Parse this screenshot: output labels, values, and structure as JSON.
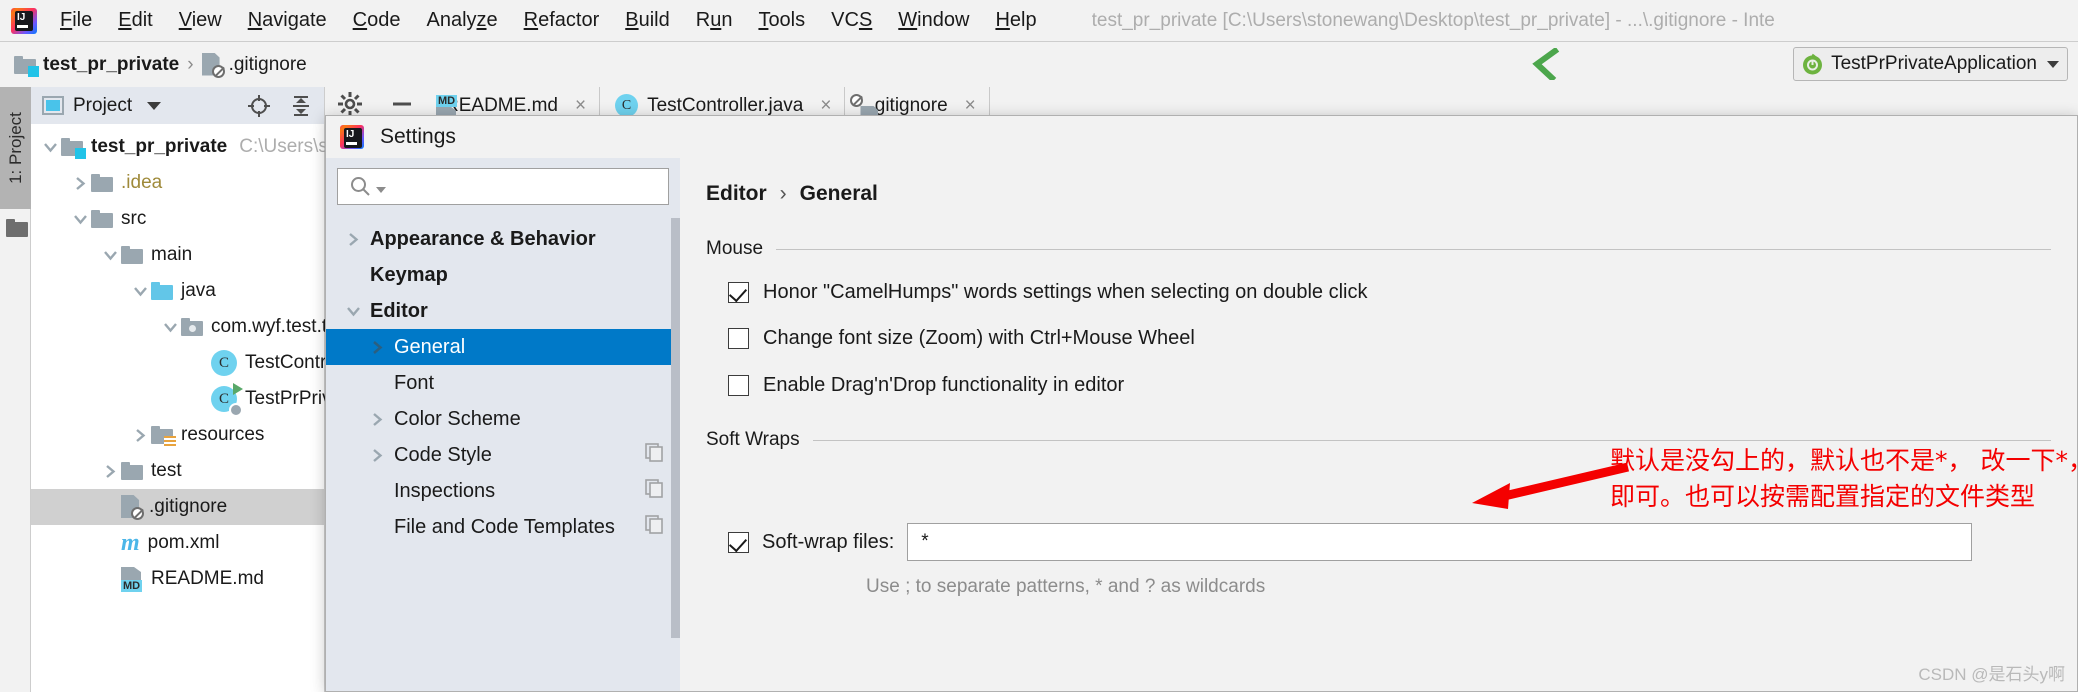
{
  "window": {
    "title": "test_pr_private [C:\\Users\\stonewang\\Desktop\\test_pr_private] - ...\\.gitignore - Inte",
    "logo_text": "IJ"
  },
  "menu": [
    {
      "label": "File",
      "mnemonic": "F"
    },
    {
      "label": "Edit",
      "mnemonic": "E"
    },
    {
      "label": "View",
      "mnemonic": "V"
    },
    {
      "label": "Navigate",
      "mnemonic": "N"
    },
    {
      "label": "Code",
      "mnemonic": "C"
    },
    {
      "label": "Analyze",
      "mnemonic": "z"
    },
    {
      "label": "Refactor",
      "mnemonic": "R"
    },
    {
      "label": "Build",
      "mnemonic": "B"
    },
    {
      "label": "Run",
      "mnemonic": "u"
    },
    {
      "label": "Tools",
      "mnemonic": "T"
    },
    {
      "label": "VCS",
      "mnemonic": "S"
    },
    {
      "label": "Window",
      "mnemonic": "W"
    },
    {
      "label": "Help",
      "mnemonic": "H"
    }
  ],
  "navbar": {
    "crumb_project": "test_pr_private",
    "crumb_file": ".gitignore",
    "separator": "›",
    "run_config": "TestPrPrivateApplication"
  },
  "tool_stripe": {
    "project_tab": "1: Project"
  },
  "project_panel": {
    "header_title": "Project",
    "tree": [
      {
        "label": "test_pr_private",
        "path": "C:\\Users\\sto",
        "depth": 0,
        "icon": "folder-module",
        "twisty": "down",
        "bold": true,
        "selected": false
      },
      {
        "label": ".idea",
        "path": "",
        "depth": 1,
        "icon": "folder",
        "twisty": "right",
        "bold": false,
        "selected": false
      },
      {
        "label": "src",
        "path": "",
        "depth": 1,
        "icon": "folder",
        "twisty": "down",
        "bold": false,
        "selected": false
      },
      {
        "label": "main",
        "path": "",
        "depth": 2,
        "icon": "folder",
        "twisty": "down",
        "bold": false,
        "selected": false
      },
      {
        "label": "java",
        "path": "",
        "depth": 3,
        "icon": "folder-source",
        "twisty": "down",
        "bold": false,
        "selected": false
      },
      {
        "label": "com.wyf.test.t",
        "path": "",
        "depth": 4,
        "icon": "folder-package",
        "twisty": "down",
        "bold": false,
        "selected": false
      },
      {
        "label": "TestContr",
        "path": "",
        "depth": 5,
        "icon": "java-class",
        "twisty": "none",
        "bold": false,
        "selected": false
      },
      {
        "label": "TestPrPriv",
        "path": "",
        "depth": 5,
        "icon": "java-class-runnable",
        "twisty": "none",
        "bold": false,
        "selected": false
      },
      {
        "label": "resources",
        "path": "",
        "depth": 3,
        "icon": "folder-resources",
        "twisty": "right",
        "bold": false,
        "selected": false
      },
      {
        "label": "test",
        "path": "",
        "depth": 2,
        "icon": "folder",
        "twisty": "right",
        "bold": false,
        "selected": false
      },
      {
        "label": ".gitignore",
        "path": "",
        "depth": 2,
        "icon": "gitignore-file",
        "twisty": "none",
        "bold": false,
        "selected": true
      },
      {
        "label": "pom.xml",
        "path": "",
        "depth": 2,
        "icon": "maven-file",
        "twisty": "none",
        "bold": false,
        "selected": false
      },
      {
        "label": "README.md",
        "path": "",
        "depth": 2,
        "icon": "markdown-file",
        "twisty": "none",
        "bold": false,
        "selected": false
      }
    ]
  },
  "editor_tabs": [
    {
      "label": "README.md",
      "icon": "markdown-file",
      "close": "×",
      "active": false
    },
    {
      "label": "TestController.java",
      "icon": "java-class",
      "close": "×",
      "active": false
    },
    {
      "label": ".gitignore",
      "icon": "gitignore-file",
      "close": "×",
      "active": true
    }
  ],
  "settings_dialog": {
    "title": "Settings",
    "search_placeholder": "",
    "search_value": "",
    "tree": [
      {
        "label": "Appearance & Behavior",
        "twisty": "right",
        "bold": true,
        "indent": 0,
        "selected": false,
        "copy_icon": false
      },
      {
        "label": "Keymap",
        "twisty": "none",
        "bold": true,
        "indent": 0,
        "selected": false,
        "copy_icon": false
      },
      {
        "label": "Editor",
        "twisty": "down",
        "bold": true,
        "indent": 0,
        "selected": false,
        "copy_icon": false
      },
      {
        "label": "General",
        "twisty": "right",
        "bold": false,
        "indent": 1,
        "selected": true,
        "copy_icon": false
      },
      {
        "label": "Font",
        "twisty": "none",
        "bold": false,
        "indent": 1,
        "selected": false,
        "copy_icon": false
      },
      {
        "label": "Color Scheme",
        "twisty": "right",
        "bold": false,
        "indent": 1,
        "selected": false,
        "copy_icon": false
      },
      {
        "label": "Code Style",
        "twisty": "right",
        "bold": false,
        "indent": 1,
        "selected": false,
        "copy_icon": true
      },
      {
        "label": "Inspections",
        "twisty": "none",
        "bold": false,
        "indent": 1,
        "selected": false,
        "copy_icon": true
      },
      {
        "label": "File and Code Templates",
        "twisty": "none",
        "bold": false,
        "indent": 1,
        "selected": false,
        "copy_icon": true
      }
    ],
    "breadcrumb": {
      "parent": "Editor",
      "separator": "›",
      "current": "General"
    },
    "mouse_group_label": "Mouse",
    "checkboxes": [
      {
        "label": "Honor \"CamelHumps\" words settings when selecting on double click",
        "checked": true
      },
      {
        "label": "Change font size (Zoom) with Ctrl+Mouse Wheel",
        "checked": false
      },
      {
        "label": "Enable Drag'n'Drop functionality in editor",
        "checked": false
      }
    ],
    "soft_wraps_group_label": "Soft Wraps",
    "soft_wrap_checkbox": {
      "label": "Soft-wrap files:",
      "checked": true
    },
    "soft_wrap_value": "*",
    "soft_wrap_hint": "Use ; to separate patterns, * and ? as wildcards"
  },
  "annotation": {
    "line1": "默认是没勾上的，默认也不是*， 改一下*， 勾上",
    "line2": "即可。也可以按需配置指定的文件类型",
    "color": "#f40000"
  },
  "watermark": "CSDN @是石头y啊",
  "colors": {
    "accent_selection": "#0079c8",
    "panel_bg": "#f2f2f2",
    "settings_tree_bg": "#e3e7ee",
    "annotation_red": "#f40000",
    "tree_selection": "#d0d0d0"
  }
}
